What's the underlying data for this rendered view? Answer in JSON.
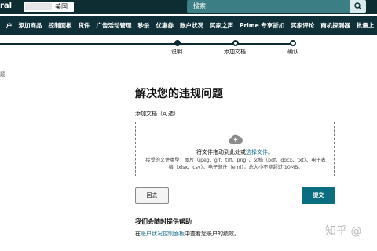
{
  "topbar": {
    "brand_fragment": "ral",
    "store_country": "美国",
    "search_placeholder": "搜索"
  },
  "nav": {
    "items": [
      "户",
      "添加商品",
      "控制面板",
      "货件",
      "广告活动管理",
      "秒杀",
      "优惠券",
      "账户状况",
      "买家之声",
      "Prime 专享折扣",
      "买家评论",
      "商机探测器",
      "批量上"
    ]
  },
  "stepper": {
    "steps": [
      "说明",
      "添加文档",
      "确认"
    ],
    "current_step": 2
  },
  "side": {
    "edge_text": "题"
  },
  "main": {
    "title": "解决您的违规问题",
    "upload_label": "添加文档（可选）",
    "drop_text": "将文件拖动到此处或",
    "drop_link": "选择文件。",
    "file_types": "接受的文件类型：图片（jpeg、gif、tiff、png）、文档（pdf、docx、txt）、电子表格（xlsx、csv）、电子邮件（eml），总大小不能超过 10MB。",
    "back_label": "回去",
    "submit_label": "提交"
  },
  "help": {
    "title": "我们会随时提供帮助",
    "prefix": "在",
    "link": "账户状况控制面板",
    "suffix": "中查看您账户的绩效。"
  },
  "watermark": "知乎 @",
  "colors": {
    "topbar": "#0d2d33",
    "nav": "#0f3038",
    "search": "#3b7f84",
    "primary_button": "#0a6e80",
    "link": "#1a6f8c"
  }
}
